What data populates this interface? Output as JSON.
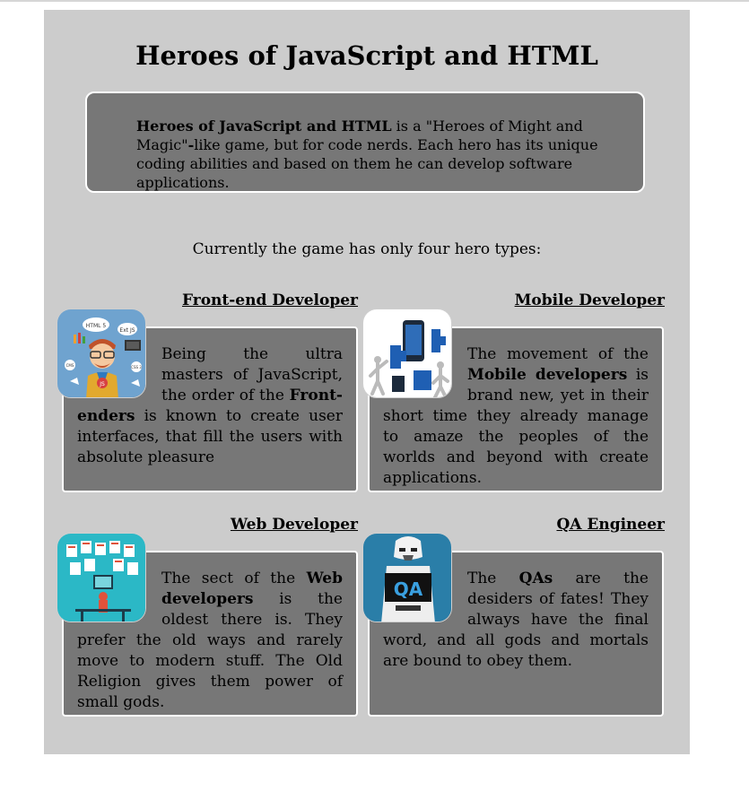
{
  "page": {
    "title": "Heroes of JavaScript and HTML",
    "intro": {
      "bold": "Heroes of JavaScript and HTML",
      "rest1": " is a \"Heroes of Might and Magic\"",
      "dash": "-",
      "rest2": "like game, but for code nerds. Each hero has its unique coding abilities and based on them he can develop software applications."
    },
    "subtitle": "Currently the game has only four hero types:"
  },
  "heroes": [
    {
      "name": "Front-end Developer",
      "icon": "front-end-developer-avatar",
      "text_before": "Being the ultra masters of JavaScript, the order of the ",
      "text_bold": "Front-enders",
      "text_after": " is known to create user interfaces, that fill the users with absolute pleasure",
      "avatar_labels": [
        "HTML 5",
        "Ext JS",
        "JS",
        "CMS",
        "CSS 3"
      ]
    },
    {
      "name": "Mobile Developer",
      "icon": "mobile-developer-avatar",
      "text_before": "The movement of the ",
      "text_bold": "Mobile developers",
      "text_after": " is brand new, yet in their short time they already manage to amaze the peoples of the worlds and beyond with create applications."
    },
    {
      "name": "Web Developer",
      "icon": "web-developer-avatar",
      "text_before": "The sect of the ",
      "text_bold": "Web developers",
      "text_after": " is the oldest there is. They prefer the old ways and rarely move to modern stuff. The Old Religion gives them power of small gods."
    },
    {
      "name": "QA Engineer",
      "icon": "qa-engineer-avatar",
      "text_before": "The ",
      "text_bold": "QAs",
      "text_after": " are the desiders of fates! They always have the final word, and all gods and mortals are bound to obey them.",
      "avatar_labels": [
        "QA"
      ]
    }
  ],
  "colors": {
    "page_background": "#cccccc",
    "card_background": "#777777",
    "card_border": "#ffffff"
  }
}
